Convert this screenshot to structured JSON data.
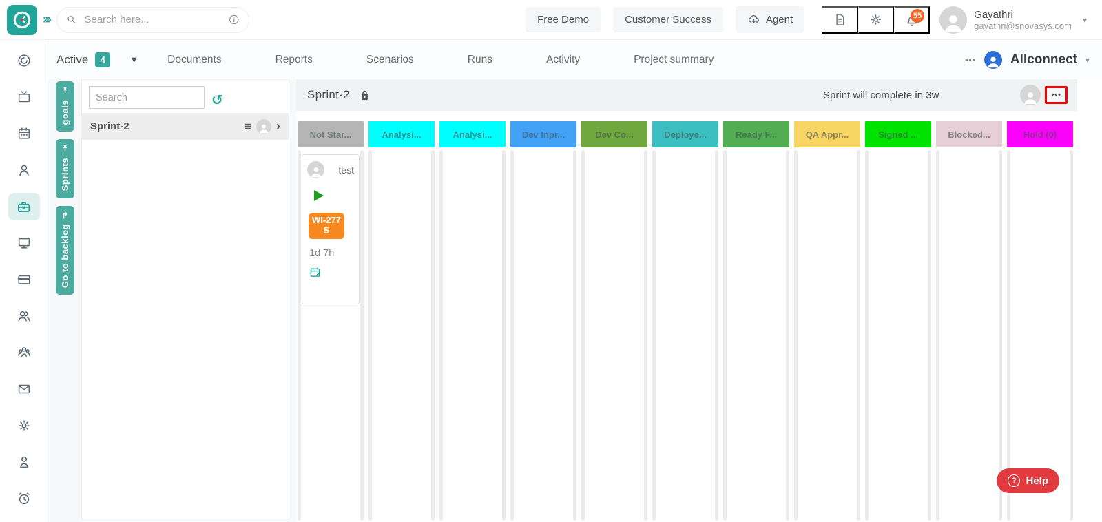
{
  "header": {
    "search_placeholder": "Search here...",
    "buttons": {
      "free_demo": "Free Demo",
      "customer_success": "Customer Success",
      "agent": "Agent"
    },
    "notification_count": "55",
    "user": {
      "name": "Gayathri",
      "email": "gayathri@snovasys.com"
    }
  },
  "project_nav": {
    "active_label": "Active",
    "active_count": "4",
    "items": [
      "Documents",
      "Reports",
      "Scenarios",
      "Runs",
      "Activity",
      "Project summary"
    ],
    "project_name": "Allconnect"
  },
  "sidebar": {
    "icons": [
      "gauge",
      "tv",
      "calendar",
      "user",
      "briefcase",
      "monitor",
      "credit-card",
      "users",
      "team",
      "mail",
      "settings",
      "account",
      "alarm-clock"
    ],
    "active_icon": "briefcase"
  },
  "left_panel": {
    "search_placeholder": "Search",
    "sprint_name": "Sprint-2"
  },
  "vertical_tabs": [
    {
      "label": "goals",
      "icon": "pin-icon"
    },
    {
      "label": "Sprints",
      "icon": "pin-icon"
    },
    {
      "label": "Go to backlog",
      "icon": "return-arrow-icon"
    }
  ],
  "board": {
    "title": "Sprint-2",
    "status_message": "Sprint will complete in 3w",
    "more_icon": "•••",
    "columns": [
      {
        "label": "Not Star...",
        "color": "#b5b5b5"
      },
      {
        "label": "Analysi...",
        "color": "#00ffff"
      },
      {
        "label": "Analysi...",
        "color": "#00ffff"
      },
      {
        "label": "Dev Inpr...",
        "color": "#40a1f5"
      },
      {
        "label": "Dev Co...",
        "color": "#6fa83e"
      },
      {
        "label": "Deploye...",
        "color": "#3bbfc0"
      },
      {
        "label": "Ready F...",
        "color": "#52ae52"
      },
      {
        "label": "QA Appr...",
        "color": "#f9d664"
      },
      {
        "label": "Signed ...",
        "color": "#00e300"
      },
      {
        "label": "Blocked...",
        "color": "#e6cfd7"
      },
      {
        "label": "Hold (0)",
        "color": "#fb02fb"
      }
    ],
    "card": {
      "assignee": "test",
      "work_item_id": "WI-2775",
      "time_logged": "1d 7h",
      "column_index": 0
    }
  },
  "help": {
    "label": "Help"
  },
  "colors": {
    "brand_teal": "#21a49a",
    "vertical_tab_teal": "#4cab9f",
    "badge_orange": "#f6891f",
    "notification_orange": "#f26522",
    "help_red": "#e23b3f",
    "highlight_red": "#ff0000"
  }
}
